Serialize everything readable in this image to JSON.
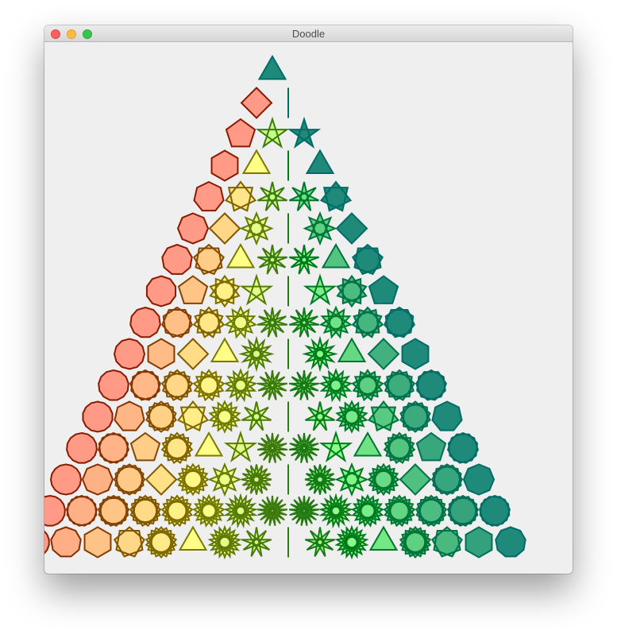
{
  "window": {
    "title": "Doodle"
  },
  "doodle": {
    "description_rows": 16,
    "palette": {
      "fill_start": "#ff9a86",
      "fill_mid": "#ffff88",
      "fill_light_green": "#88ff88",
      "fill_teal": "#1f8a7a",
      "stroke_start": "#8a1a00",
      "stroke_mid": "#7a7a00",
      "stroke_green": "#007a1a",
      "stroke_teal": "#006c66"
    }
  }
}
